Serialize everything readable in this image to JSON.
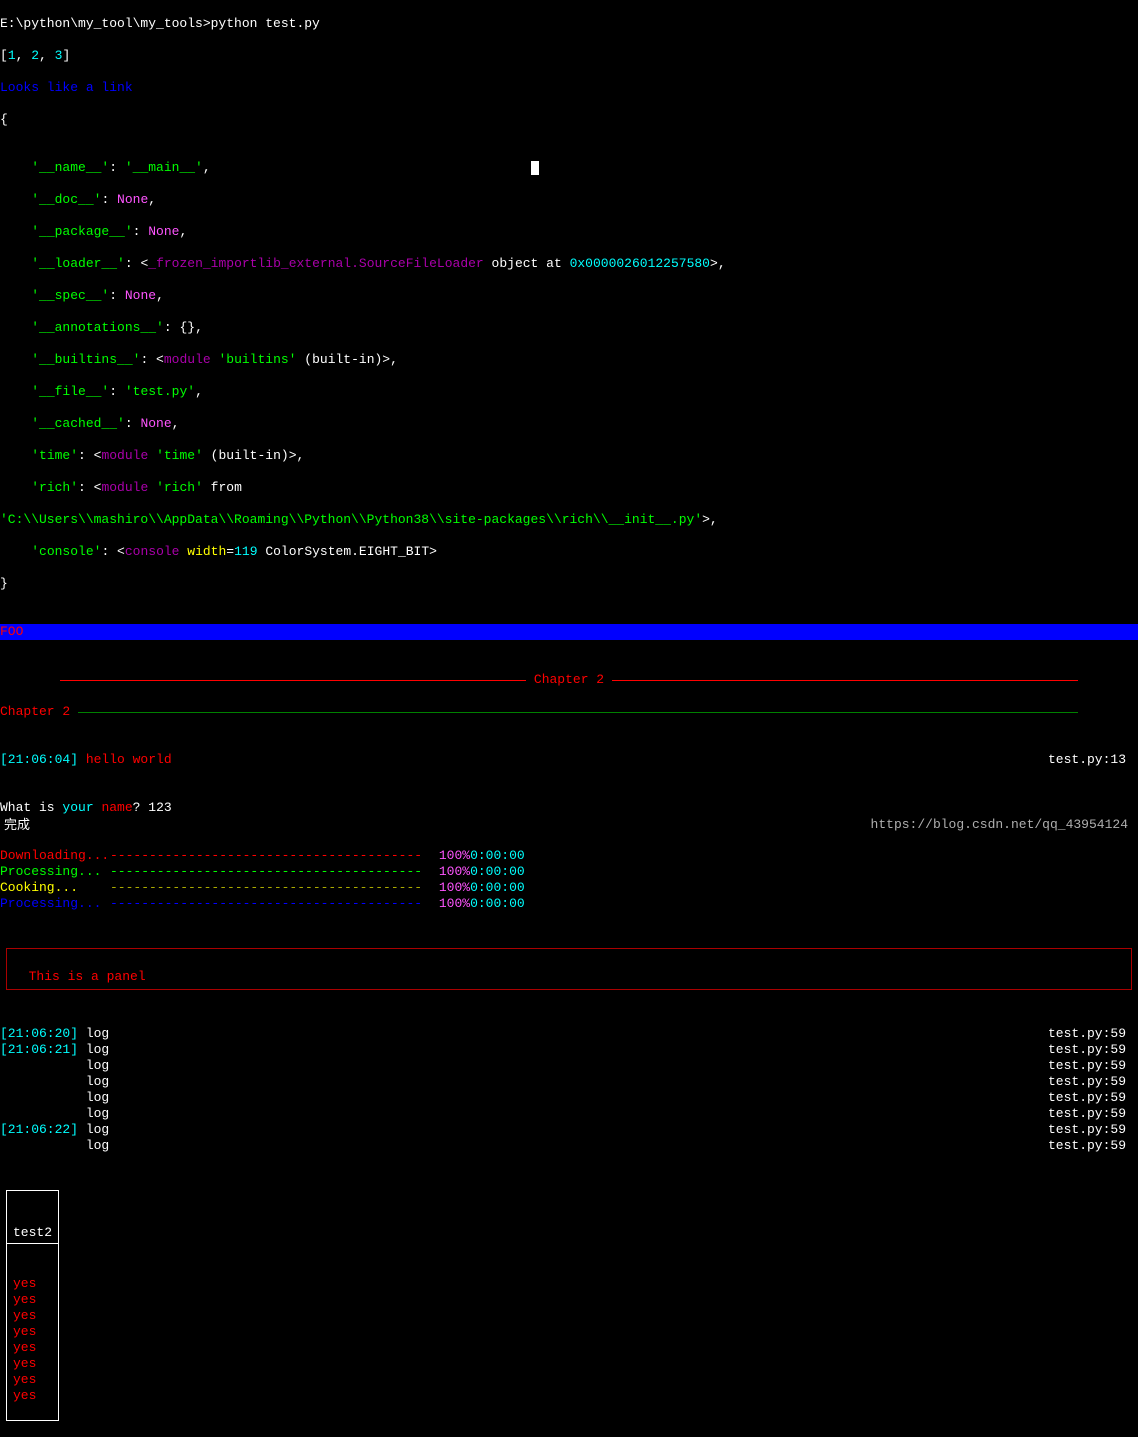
{
  "prompt": "E:\\python\\my_tool\\my_tools>python test.py",
  "list_literal": {
    "open": "[",
    "v1": "1",
    "c1": ", ",
    "v2": "2",
    "c2": ", ",
    "v3": "3",
    "close": "]"
  },
  "link_line": "Looks like a link",
  "brace_open": "{",
  "dict": {
    "indent": "    ",
    "name_key": "'__name__'",
    "name_val": "'__main__'",
    "doc_key": "'__doc__'",
    "doc_val": "None",
    "package_key": "'__package__'",
    "package_val": "None",
    "loader_key": "'__loader__'",
    "loader_val_lt": "<",
    "loader_class": "_frozen_importlib_external.SourceFileLoader",
    "loader_mid": " object at ",
    "loader_addr": "0x0000026012257580",
    "loader_gt": ">",
    "spec_key": "'__spec__'",
    "spec_val": "None",
    "annot_key": "'__annotations__'",
    "annot_val_open": "{",
    "annot_val_close": "}",
    "builtins_key": "'__builtins__'",
    "builtins_val_1": "<",
    "builtins_val_2": "module ",
    "builtins_val_3": "'builtins'",
    "builtins_val_4": " (built-in)>",
    "file_key": "'__file__'",
    "file_val": "'test.py'",
    "cached_key": "'__cached__'",
    "cached_val": "None",
    "time_key": "'time'",
    "time_val_2": "module ",
    "time_val_3": "'time'",
    "time_val_4": " (built-in)>",
    "rich_key": "'rich'",
    "rich_val_2": "module ",
    "rich_val_3": "'rich'",
    "rich_from": " from",
    "rich_path": "'C:\\\\Users\\\\mashiro\\\\AppData\\\\Roaming\\\\Python\\\\Python38\\\\site-packages\\\\rich\\\\__init__.py'",
    "console_key": "'console'",
    "console_val_1": "<",
    "console_val_2": "console ",
    "console_width_k": "width",
    "console_eq": "=",
    "console_width_v": "119",
    "console_rest": " ColorSystem.EIGHT_BIT>"
  },
  "brace_close": "}",
  "foo": "FOO",
  "rule_center_label": " Chapter 2 ",
  "rule_left_label": "Chapter 2 ",
  "log_hello_ts": "[21:06:04]",
  "log_hello_msg": " hello world",
  "log_hello_src": "test.py:13",
  "ask_prefix": "What is ",
  "ask_your": "your",
  "ask_name": " name",
  "ask_qmark": "? ",
  "ask_answer": "123",
  "bars": [
    {
      "label": "Downloading...",
      "cls": "progress-bar",
      "pct": "100%",
      "time": "0:00:00",
      "pct_cls": "magenta"
    },
    {
      "label": "Processing...",
      "cls": "progress-bar g",
      "pct": "100%",
      "time": "0:00:00",
      "pct_cls": "magenta"
    },
    {
      "label": "Cooking...",
      "cls": "progress-bar y",
      "pct": "100%",
      "time": "0:00:00",
      "pct_cls": "magenta"
    },
    {
      "label": "Processing...",
      "cls": "progress-bar b",
      "pct": "100%",
      "time": "0:00:00",
      "pct_cls": "magenta"
    }
  ],
  "bar_line": "----------------------------------------",
  "panel_text": "This is a panel",
  "logs": [
    {
      "ts": "[21:06:20]",
      "msg": "log",
      "src": "test.py:59"
    },
    {
      "ts": "[21:06:21]",
      "msg": "log",
      "src": "test.py:59"
    },
    {
      "ts": "",
      "msg": "log",
      "src": "test.py:59"
    },
    {
      "ts": "",
      "msg": "log",
      "src": "test.py:59"
    },
    {
      "ts": "",
      "msg": "log",
      "src": "test.py:59"
    },
    {
      "ts": "",
      "msg": "log",
      "src": "test.py:59"
    },
    {
      "ts": "[21:06:22]",
      "msg": "log",
      "src": "test.py:59"
    },
    {
      "ts": "",
      "msg": "log",
      "src": "test.py:59"
    }
  ],
  "table_header": "test2",
  "table_rows": [
    "yes",
    "yes",
    "yes",
    "yes",
    "yes",
    "yes",
    "yes",
    "yes"
  ],
  "completed": "完成",
  "watermark": "https://blog.csdn.net/qq_43954124"
}
